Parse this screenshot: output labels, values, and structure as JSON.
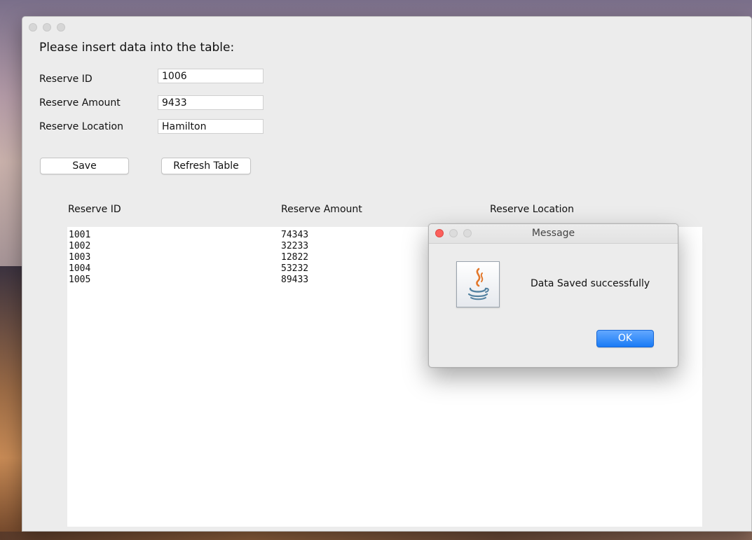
{
  "form": {
    "heading": "Please insert data into the table:",
    "fields": [
      {
        "label": "Reserve ID",
        "value": "1006"
      },
      {
        "label": "Reserve Amount",
        "value": "9433"
      },
      {
        "label": "Reserve Location",
        "value": "Hamilton"
      }
    ],
    "save_label": "Save",
    "refresh_label": "Refresh Table"
  },
  "table": {
    "columns": [
      "Reserve ID",
      "Reserve Amount",
      "Reserve Location"
    ],
    "rows": [
      [
        "1001",
        "74343",
        ""
      ],
      [
        "1002",
        "32233",
        ""
      ],
      [
        "1003",
        "12822",
        ""
      ],
      [
        "1004",
        "53232",
        ""
      ],
      [
        "1005",
        "89433",
        ""
      ]
    ]
  },
  "dialog": {
    "title": "Message",
    "message": "Data Saved successfully",
    "ok_label": "OK",
    "icon": "java-icon",
    "accent_color": "#1a7bf5"
  }
}
